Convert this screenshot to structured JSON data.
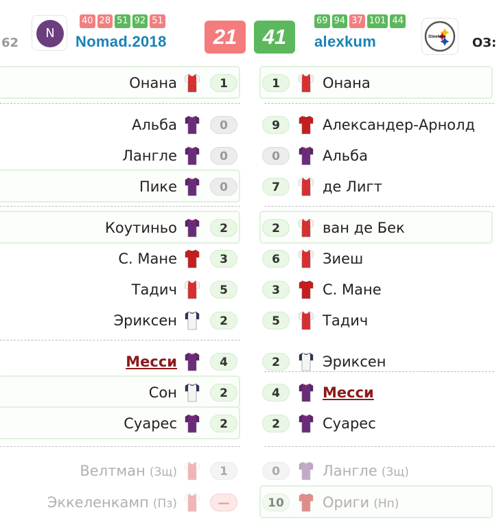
{
  "header": {
    "left_edge_number": "62",
    "right_edge_label": "ОЗ: ",
    "left_team": {
      "avatar_letter": "N",
      "name": "Nomad.2018",
      "round_scores": [
        {
          "value": "40",
          "color": "#f08080"
        },
        {
          "value": "28",
          "color": "#f08080"
        },
        {
          "value": "51",
          "color": "#5cb85c"
        },
        {
          "value": "92",
          "color": "#5cb85c"
        },
        {
          "value": "51",
          "color": "#f08080"
        }
      ],
      "score": "21",
      "score_color": "#f47c7c"
    },
    "right_team": {
      "avatar_icon": "steelers-logo-icon",
      "logo_text": "Steelers",
      "name": "alexkum",
      "round_scores": [
        {
          "value": "69",
          "color": "#5cb85c"
        },
        {
          "value": "94",
          "color": "#5cb85c"
        },
        {
          "value": "37",
          "color": "#f08080"
        },
        {
          "value": "101",
          "color": "#5cb85c"
        },
        {
          "value": "44",
          "color": "#5cb85c"
        }
      ],
      "score": "41",
      "score_color": "#5cb85c"
    }
  },
  "left_rows": [
    {
      "name": "Онана",
      "pos": "",
      "pts": "1",
      "kit": "red-white",
      "style": "normal",
      "ptsStyle": "pos-pts",
      "hl": true
    },
    {
      "name": "Альба",
      "pos": "",
      "pts": "0",
      "kit": "purple",
      "style": "normal",
      "ptsStyle": "zero",
      "hl": false
    },
    {
      "name": "Лангле",
      "pos": "",
      "pts": "0",
      "kit": "purple",
      "style": "normal",
      "ptsStyle": "zero",
      "hl": false
    },
    {
      "name": "Пике",
      "pos": "",
      "pts": "0",
      "kit": "purple",
      "style": "normal",
      "ptsStyle": "zero",
      "hl": true
    },
    {
      "name": "Коутиньо",
      "pos": "",
      "pts": "2",
      "kit": "purple",
      "style": "normal",
      "ptsStyle": "pos-pts",
      "hl": true
    },
    {
      "name": "С. Мане",
      "pos": "",
      "pts": "3",
      "kit": "red",
      "style": "normal",
      "ptsStyle": "pos-pts",
      "hl": false
    },
    {
      "name": "Тадич",
      "pos": "",
      "pts": "5",
      "kit": "red-white",
      "style": "normal",
      "ptsStyle": "pos-pts",
      "hl": false
    },
    {
      "name": "Эриксен",
      "pos": "",
      "pts": "2",
      "kit": "white-navy",
      "style": "normal",
      "ptsStyle": "pos-pts",
      "hl": false
    },
    {
      "name": "Месси",
      "pos": "",
      "pts": "4",
      "kit": "purple",
      "style": "captain",
      "ptsStyle": "pos-pts",
      "hl": false
    },
    {
      "name": "Сон",
      "pos": "",
      "pts": "2",
      "kit": "white-navy",
      "style": "normal",
      "ptsStyle": "pos-pts",
      "hl": true
    },
    {
      "name": "Суарес",
      "pos": "",
      "pts": "2",
      "kit": "purple",
      "style": "normal",
      "ptsStyle": "pos-pts",
      "hl": true
    },
    {
      "name": "Велтман",
      "pos": "(Зщ)",
      "pts": "1",
      "kit": "red-white-faded",
      "style": "faded",
      "ptsStyle": "faded",
      "hl": false
    },
    {
      "name": "Эккеленкамп",
      "pos": "(Пз)",
      "pts": "—",
      "kit": "red-white-faded",
      "style": "faded",
      "ptsStyle": "dash",
      "hl": false
    }
  ],
  "right_rows": [
    {
      "name": "Онана",
      "pos": "",
      "pts": "1",
      "kit": "red-white",
      "style": "normal",
      "ptsStyle": "pos-pts",
      "hl": true
    },
    {
      "name": "Александер-Арнолд",
      "pos": "",
      "pts": "9",
      "kit": "red",
      "style": "normal",
      "ptsStyle": "pos-pts",
      "hl": false
    },
    {
      "name": "Альба",
      "pos": "",
      "pts": "0",
      "kit": "purple",
      "style": "normal",
      "ptsStyle": "zero",
      "hl": false
    },
    {
      "name": "де Лигт",
      "pos": "",
      "pts": "7",
      "kit": "red-white",
      "style": "normal",
      "ptsStyle": "pos-pts",
      "hl": false
    },
    {
      "name": "ван де Бек",
      "pos": "",
      "pts": "2",
      "kit": "red-white",
      "style": "normal",
      "ptsStyle": "pos-pts",
      "hl": true
    },
    {
      "name": "Зиеш",
      "pos": "",
      "pts": "6",
      "kit": "red-white",
      "style": "normal",
      "ptsStyle": "pos-pts",
      "hl": false
    },
    {
      "name": "С. Мане",
      "pos": "",
      "pts": "3",
      "kit": "red",
      "style": "normal",
      "ptsStyle": "pos-pts",
      "hl": false
    },
    {
      "name": "Тадич",
      "pos": "",
      "pts": "5",
      "kit": "red-white",
      "style": "normal",
      "ptsStyle": "pos-pts",
      "hl": false
    },
    {
      "name": "Эриксен",
      "pos": "",
      "pts": "2",
      "kit": "white-navy",
      "style": "normal",
      "ptsStyle": "pos-pts",
      "hl": false
    },
    {
      "name": "Месси",
      "pos": "",
      "pts": "4",
      "kit": "purple",
      "style": "captain",
      "ptsStyle": "pos-pts",
      "hl": false
    },
    {
      "name": "Суарес",
      "pos": "",
      "pts": "2",
      "kit": "purple",
      "style": "normal",
      "ptsStyle": "pos-pts",
      "hl": false
    },
    {
      "name": "Лангле",
      "pos": "(Зщ)",
      "pts": "0",
      "kit": "purple-faded",
      "style": "faded",
      "ptsStyle": "faded",
      "hl": false
    },
    {
      "name": "Ориги",
      "pos": "(Нп)",
      "pts": "10",
      "kit": "red-faded",
      "style": "faded",
      "ptsStyle": "fadegreen",
      "hl": true
    }
  ]
}
